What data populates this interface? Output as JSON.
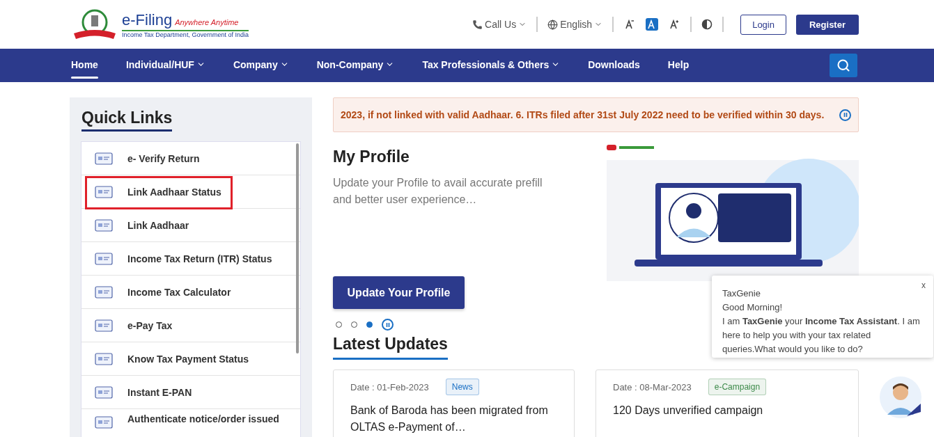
{
  "header": {
    "logo_title": "e-Filing",
    "logo_tagline": "Anywhere Anytime",
    "logo_subtitle": "Income Tax Department, Government of India",
    "call_us": "Call Us",
    "language": "English",
    "font_sizes": [
      {
        "kind": "decrease",
        "selected": false
      },
      {
        "kind": "normal",
        "selected": true
      },
      {
        "kind": "increase",
        "selected": false
      }
    ],
    "login": "Login",
    "register": "Register"
  },
  "nav": [
    {
      "label": "Home",
      "selected": true,
      "dropdown": false
    },
    {
      "label": "Individual/HUF",
      "selected": false,
      "dropdown": true
    },
    {
      "label": "Company",
      "selected": false,
      "dropdown": true
    },
    {
      "label": "Non-Company",
      "selected": false,
      "dropdown": true
    },
    {
      "label": "Tax Professionals & Others",
      "selected": false,
      "dropdown": true
    },
    {
      "label": "Downloads",
      "selected": false,
      "dropdown": false
    },
    {
      "label": "Help",
      "selected": false,
      "dropdown": false
    }
  ],
  "quick_links": {
    "title": "Quick Links",
    "items": [
      {
        "label": "e- Verify Return",
        "highlighted": false
      },
      {
        "label": "Link Aadhaar Status",
        "highlighted": true
      },
      {
        "label": "Link Aadhaar",
        "highlighted": false
      },
      {
        "label": "Income Tax Return (ITR) Status",
        "highlighted": false
      },
      {
        "label": "Income Tax Calculator",
        "highlighted": false
      },
      {
        "label": "e-Pay Tax",
        "highlighted": false
      },
      {
        "label": "Know Tax Payment Status",
        "highlighted": false
      },
      {
        "label": "Instant E-PAN",
        "highlighted": false
      },
      {
        "label": "Authenticate notice/order issued",
        "highlighted": false
      }
    ]
  },
  "ticker": "2023, if not linked with valid Aadhaar. 6. ITRs filed after 31st July 2022 need to be verified within 30 days.",
  "profile": {
    "title": "My Profile",
    "text": "Update your Profile to avail accurate prefill and better user experience…",
    "button": "Update Your Profile",
    "slides": [
      {
        "selected": false
      },
      {
        "selected": false
      },
      {
        "selected": true
      }
    ]
  },
  "latest_updates": {
    "title": "Latest Updates",
    "cards": [
      {
        "date": "Date : 01-Feb-2023",
        "tag": "News",
        "color": "#1a6fc4",
        "text": "Bank of Baroda has been migrated from OLTAS e-Payment of…"
      },
      {
        "date": "Date : 08-Mar-2023",
        "tag": "e-Campaign",
        "color": "#3d8a4a",
        "text": "120 Days unverified campaign"
      }
    ]
  },
  "chat": {
    "name": "TaxGenie",
    "greeting": "Good Morning!",
    "message": "I am **TaxGenie** your **Income Tax Assistant**. I am here to help you with your tax related queries.What would you like to do?",
    "close": "x"
  }
}
